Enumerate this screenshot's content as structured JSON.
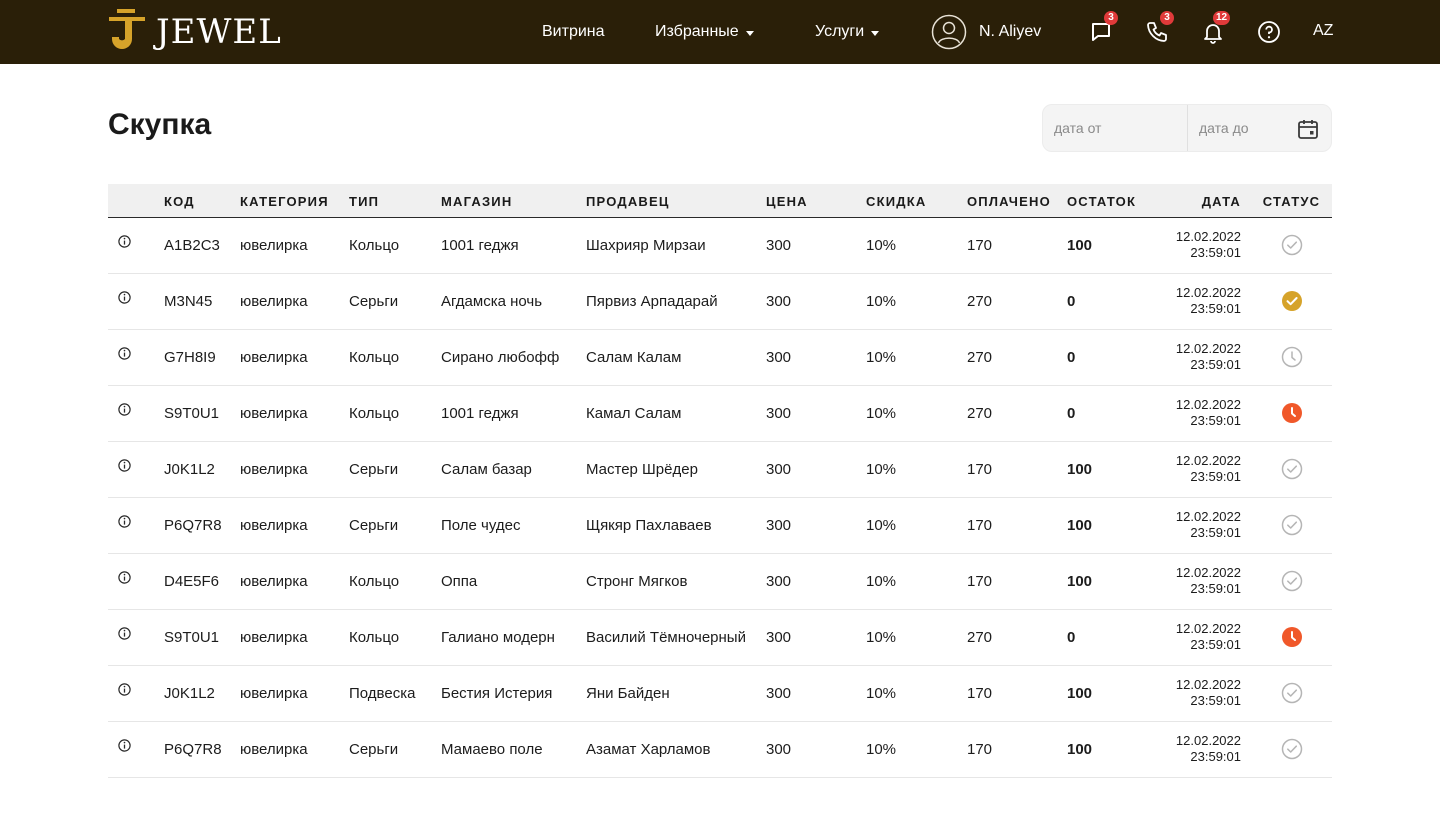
{
  "header": {
    "logo_text": "JEWEL",
    "nav": [
      {
        "label": "Витрина"
      },
      {
        "label": "Избранные"
      },
      {
        "label": "Услуги"
      }
    ],
    "user_name": "N. Aliyev",
    "badges": {
      "messages": "3",
      "calls": "3",
      "notifications": "12"
    },
    "lang": "AZ",
    "icons": [
      "user-avatar-icon",
      "chat-icon",
      "phone-icon",
      "bell-icon",
      "help-icon"
    ],
    "colors": {
      "bar": "#2a1f08",
      "brand_gold": "#d6a32a",
      "badge": "#e03a3a"
    }
  },
  "page": {
    "title": "Скупка",
    "date_from_placeholder": "дата от",
    "date_to_placeholder": "дата до"
  },
  "table": {
    "columns": [
      "",
      "КОД",
      "КАТЕГОРИЯ",
      "ТИП",
      "МАГАЗИН",
      "ПРОДАВЕЦ",
      "ЦЕНА",
      "СКИДКА",
      "ОПЛАЧЕНО",
      "ОСТАТОК",
      "ДАТА",
      "СТАТУС"
    ],
    "rows": [
      {
        "code": "A1B2C3",
        "category": "ювелирка",
        "type": "Кольцо",
        "store": "1001 геджя",
        "seller": "Шахрияр Мирзаи",
        "price": "300",
        "discount": "10%",
        "paid": "170",
        "remainder": "100",
        "date": "12.02.2022",
        "time": "23:59:01",
        "status": "done-outline"
      },
      {
        "code": "M3N45",
        "category": "ювелирка",
        "type": "Серьги",
        "store": "Агдамска ночь",
        "seller": "Пярвиз Арпадарай",
        "price": "300",
        "discount": "10%",
        "paid": "270",
        "remainder": "0",
        "date": "12.02.2022",
        "time": "23:59:01",
        "status": "done-filled"
      },
      {
        "code": "G7H8I9",
        "category": "ювелирка",
        "type": "Кольцо",
        "store": "Сирано любофф",
        "seller": "Салам Калам",
        "price": "300",
        "discount": "10%",
        "paid": "270",
        "remainder": "0",
        "date": "12.02.2022",
        "time": "23:59:01",
        "status": "pending-outline"
      },
      {
        "code": "S9T0U1",
        "category": "ювелирка",
        "type": "Кольцо",
        "store": "1001 геджя",
        "seller": "Камал Салам",
        "price": "300",
        "discount": "10%",
        "paid": "270",
        "remainder": "0",
        "date": "12.02.2022",
        "time": "23:59:01",
        "status": "pending-filled"
      },
      {
        "code": "J0K1L2",
        "category": "ювелирка",
        "type": "Серьги",
        "store": "Салам базар",
        "seller": "Мастер Шрёдер",
        "price": "300",
        "discount": "10%",
        "paid": "170",
        "remainder": "100",
        "date": "12.02.2022",
        "time": "23:59:01",
        "status": "done-outline"
      },
      {
        "code": "P6Q7R8",
        "category": "ювелирка",
        "type": "Серьги",
        "store": "Поле чудес",
        "seller": "Щякяр Пахлаваев",
        "price": "300",
        "discount": "10%",
        "paid": "170",
        "remainder": "100",
        "date": "12.02.2022",
        "time": "23:59:01",
        "status": "done-outline"
      },
      {
        "code": "D4E5F6",
        "category": "ювелирка",
        "type": "Кольцо",
        "store": "Оппа",
        "seller": "Стронг Мягков",
        "price": "300",
        "discount": "10%",
        "paid": "170",
        "remainder": "100",
        "date": "12.02.2022",
        "time": "23:59:01",
        "status": "done-outline"
      },
      {
        "code": "S9T0U1",
        "category": "ювелирка",
        "type": "Кольцо",
        "store": "Галиано модерн",
        "seller": "Василий Тёмночерный",
        "price": "300",
        "discount": "10%",
        "paid": "270",
        "remainder": "0",
        "date": "12.02.2022",
        "time": "23:59:01",
        "status": "pending-filled"
      },
      {
        "code": "J0K1L2",
        "category": "ювелирка",
        "type": "Подвеска",
        "store": "Бестия Истерия",
        "seller": "Яни Байден",
        "price": "300",
        "discount": "10%",
        "paid": "170",
        "remainder": "100",
        "date": "12.02.2022",
        "time": "23:59:01",
        "status": "done-outline"
      },
      {
        "code": "P6Q7R8",
        "category": "ювелирка",
        "type": "Серьги",
        "store": "Мамаево поле",
        "seller": "Азамат Харламов",
        "price": "300",
        "discount": "10%",
        "paid": "170",
        "remainder": "100",
        "date": "12.02.2022",
        "time": "23:59:01",
        "status": "done-outline"
      }
    ],
    "status_colors": {
      "outline": "#b5b5b5",
      "done-filled": "#d6a32a",
      "pending-filled": "#f0582a"
    }
  }
}
